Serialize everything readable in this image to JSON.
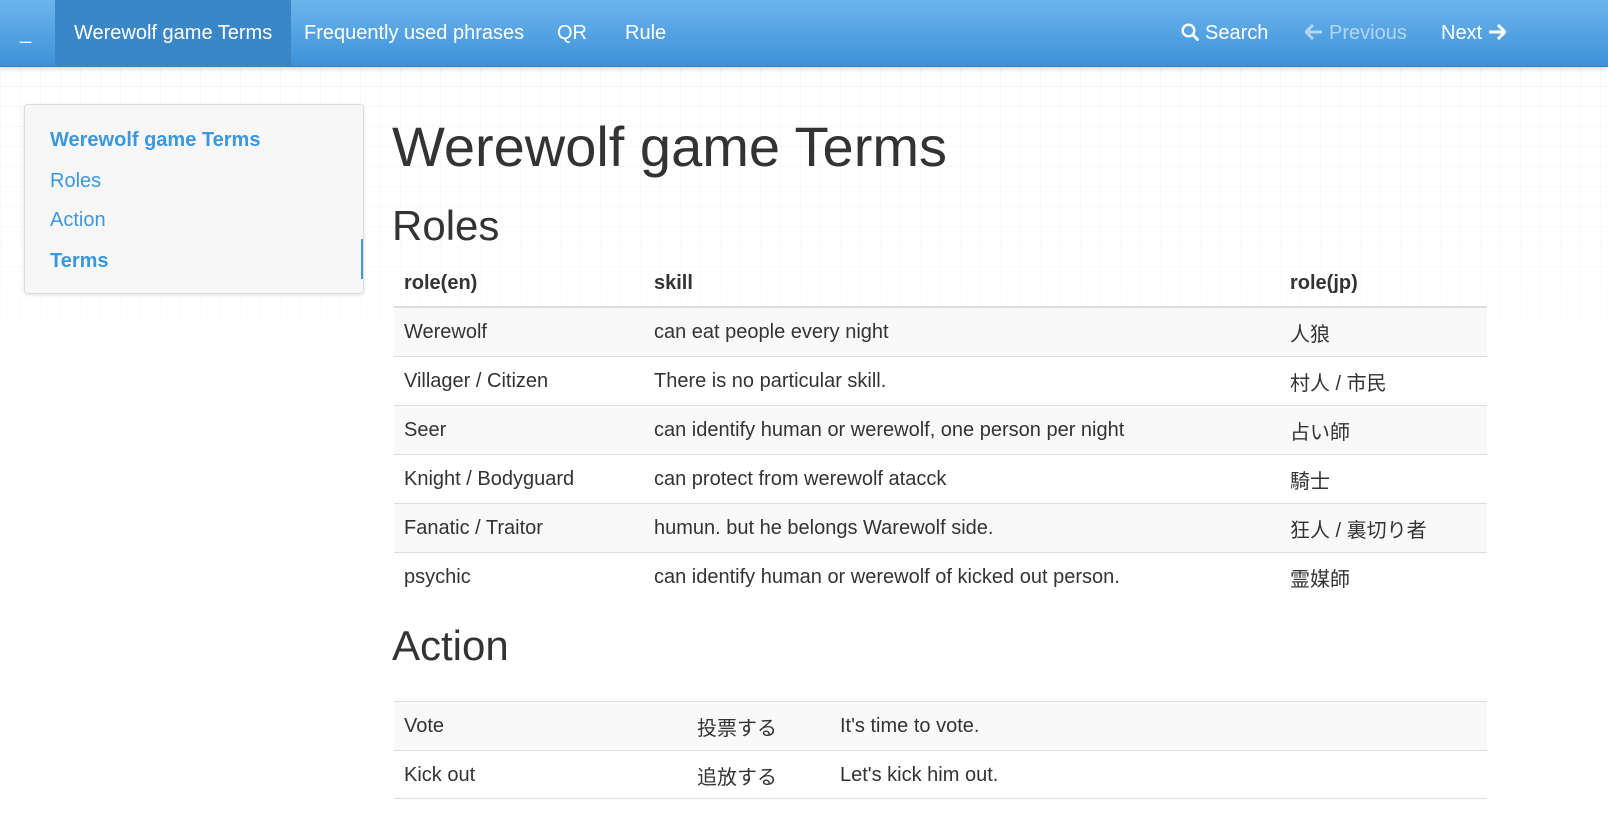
{
  "navbar": {
    "toggle_label": "_",
    "items": [
      {
        "label": "Werewolf game Terms"
      },
      {
        "label": "Frequently used phrases"
      },
      {
        "label": "QR"
      },
      {
        "label": "Rule"
      }
    ],
    "search_label": "Search",
    "search_icon": "search-icon",
    "previous_label": "Previous",
    "next_label": "Next"
  },
  "sidebar": {
    "items": [
      {
        "label": "Werewolf game Terms"
      },
      {
        "label": "Roles"
      },
      {
        "label": "Action"
      },
      {
        "label": "Terms"
      }
    ]
  },
  "page": {
    "title": "Werewolf game Terms",
    "roles_heading": "Roles",
    "action_heading": "Action"
  },
  "roles_table": {
    "headers": [
      "role(en)",
      "skill",
      "role(jp)"
    ],
    "rows": [
      [
        "Werewolf",
        "can eat people every night",
        "人狼"
      ],
      [
        "Villager / Citizen",
        "There is no particular skill.",
        "村人 / 市民"
      ],
      [
        "Seer",
        "can identify human or werewolf, one person per night",
        "占い師"
      ],
      [
        "Knight / Bodyguard",
        "can protect from werewolf atacck",
        "騎士"
      ],
      [
        "Fanatic / Traitor",
        "humun. but he belongs Warewolf side.",
        "狂人 / 裏切り者"
      ],
      [
        "psychic",
        "can identify human or werewolf of kicked out person.",
        "霊媒師"
      ]
    ]
  },
  "action_table": {
    "rows": [
      [
        "Vote",
        "投票する",
        "It's time to vote."
      ],
      [
        "Kick out",
        "追放する",
        "Let's kick him out."
      ]
    ]
  },
  "colors": {
    "navbar_top": "#6cb4ec",
    "navbar_bottom": "#3d92d9",
    "active_nav": "#3a87c8",
    "link": "#3b97de"
  }
}
